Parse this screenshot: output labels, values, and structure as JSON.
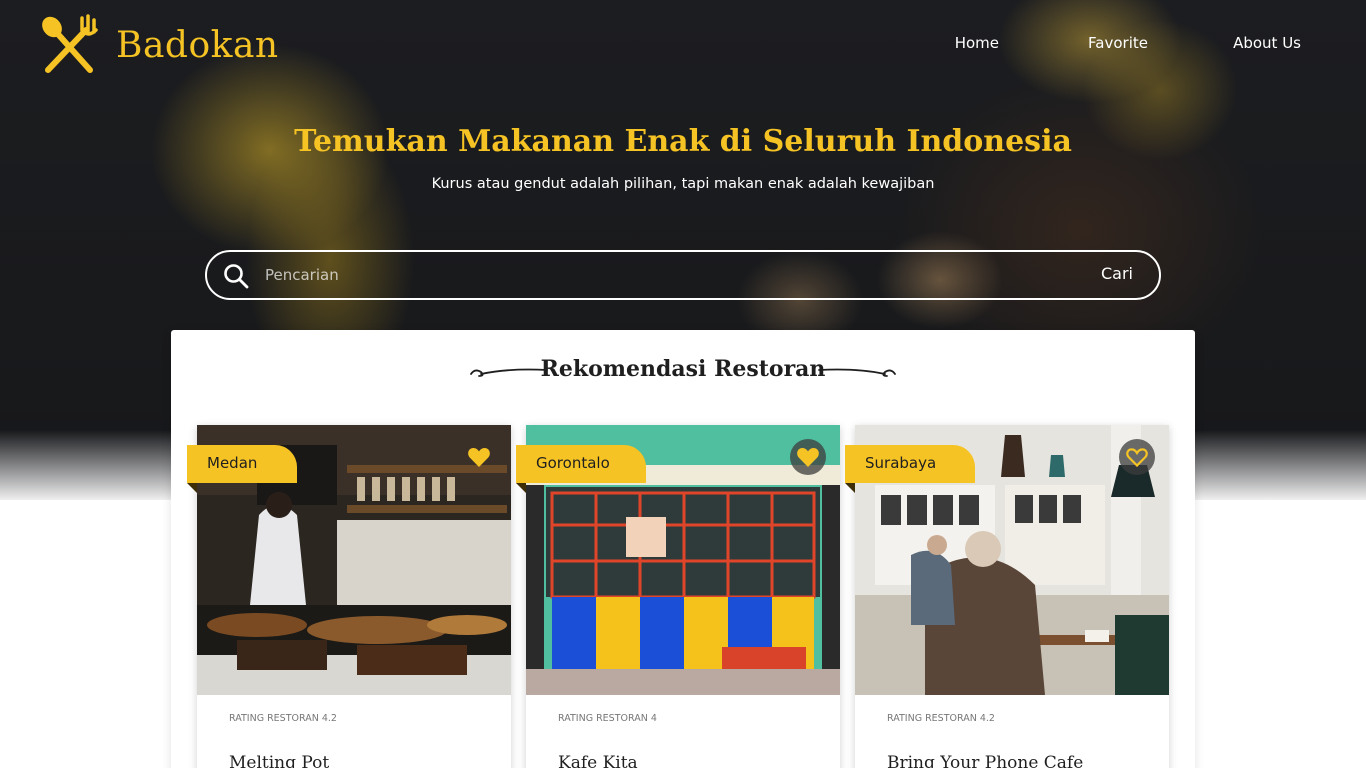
{
  "brand": {
    "name": "Badokan",
    "logo_icon": "fork-spoon-icon",
    "color": "#f6c324"
  },
  "nav": {
    "items": [
      "Home",
      "Favorite",
      "About Us"
    ]
  },
  "hero": {
    "title": "Temukan Makanan Enak di Seluruh Indonesia",
    "subtitle": "Kurus atau gendut adalah pilihan, tapi makan enak adalah kewajiban"
  },
  "search": {
    "placeholder": "Pencarian",
    "value": "",
    "button_label": "Cari",
    "icon": "search-icon"
  },
  "section": {
    "title": "Rekomendasi Restoran"
  },
  "restaurants": [
    {
      "city": "Medan",
      "rating_text": "RATING RESTORAN 4.2",
      "name": "Melting Pot",
      "favorite": true
    },
    {
      "city": "Gorontalo",
      "rating_text": "RATING RESTORAN 4",
      "name": "Kafe Kita",
      "favorite": true
    },
    {
      "city": "Surabaya",
      "rating_text": "RATING RESTORAN 4.2",
      "name": "Bring Your Phone Cafe",
      "favorite": false
    }
  ],
  "colors": {
    "accent": "#f6c324",
    "hero_bg": "#1c1d20",
    "text_dark": "#1f1f1f"
  }
}
